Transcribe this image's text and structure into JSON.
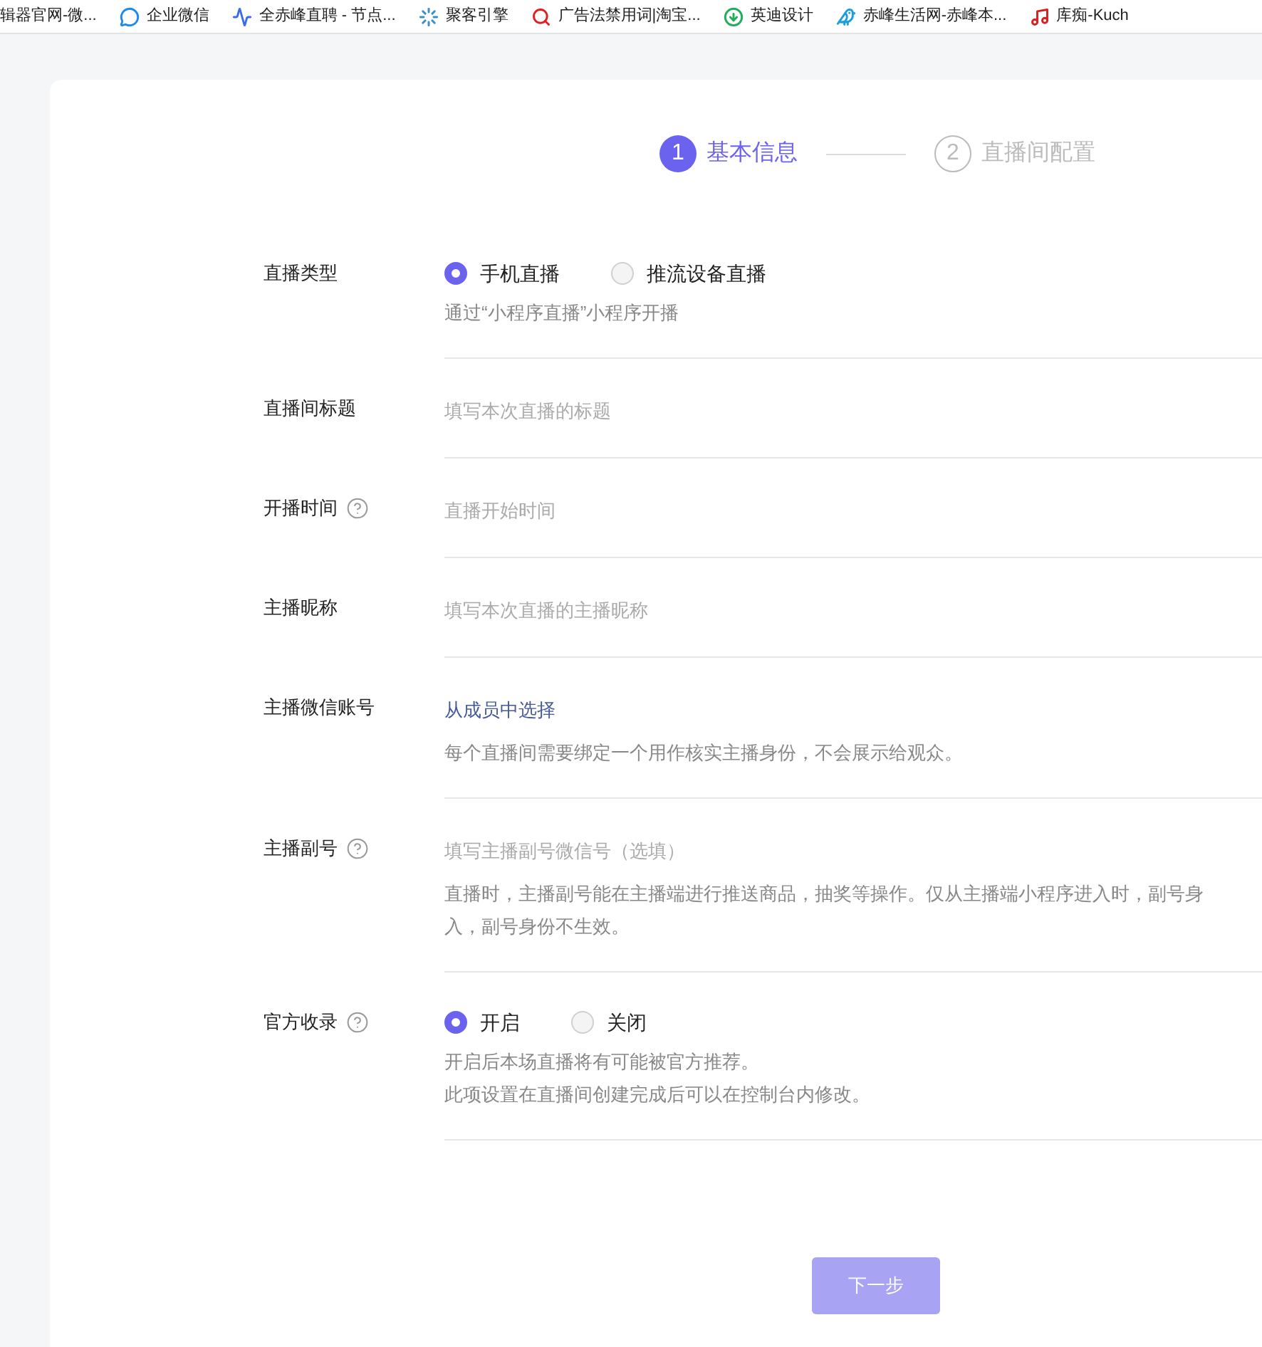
{
  "bookmarks": [
    {
      "label": "辑器官网-微..."
    },
    {
      "label": "企业微信"
    },
    {
      "label": "全赤峰直聘 - 节点..."
    },
    {
      "label": "聚客引擎"
    },
    {
      "label": "广告法禁用词|淘宝..."
    },
    {
      "label": "英迪设计"
    },
    {
      "label": "赤峰生活网-赤峰本..."
    },
    {
      "label": "库痴-Kuch"
    }
  ],
  "steps": [
    {
      "number": "1",
      "label": "基本信息",
      "selected": true
    },
    {
      "number": "2",
      "label": "直播间配置",
      "selected": false
    }
  ],
  "form_rows": [
    {
      "kind": "radio",
      "label": "直播类型",
      "help": false,
      "options": [
        {
          "label": "手机直播",
          "selected": true
        },
        {
          "label": "推流设备直播",
          "selected": false
        }
      ],
      "hints": [
        "通过“小程序直播”小程序开播"
      ]
    },
    {
      "kind": "input",
      "label": "直播间标题",
      "help": false,
      "placeholder": "填写本次直播的标题"
    },
    {
      "kind": "input",
      "label": "开播时间",
      "help": true,
      "placeholder": "直播开始时间"
    },
    {
      "kind": "input",
      "label": "主播昵称",
      "help": false,
      "placeholder": "填写本次直播的主播昵称"
    },
    {
      "kind": "link",
      "label": "主播微信账号",
      "help": false,
      "link": "从成员中选择",
      "hints": [
        "每个直播间需要绑定一个用作核实主播身份，不会展示给观众。"
      ]
    },
    {
      "kind": "input",
      "label": "主播副号",
      "help": true,
      "placeholder": "填写主播副号微信号（选填）",
      "hints": [
        "直播时，主播副号能在主播端进行推送商品，抽奖等操作。仅从主播端小程序进入时，副号身",
        "入，副号身份不生效。"
      ]
    },
    {
      "kind": "radio",
      "label": "官方收录",
      "help": true,
      "options": [
        {
          "label": "开启",
          "selected": true
        },
        {
          "label": "关闭",
          "selected": false
        }
      ],
      "hints": [
        "开启后本场直播将有可能被官方推荐。",
        "此项设置在直播间创建完成后可以在控制台内修改。"
      ]
    }
  ],
  "next_button": {
    "label": "下一步",
    "disabled": true
  }
}
